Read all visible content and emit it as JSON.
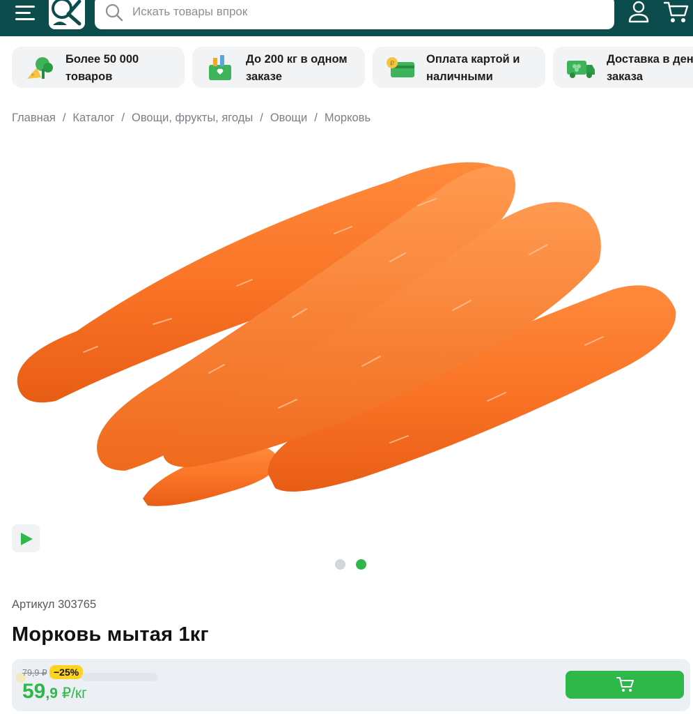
{
  "header": {
    "search_placeholder": "Искать товары впрок",
    "icons": [
      "menu-icon",
      "logo",
      "search-icon",
      "user-icon",
      "cart-icon"
    ],
    "colors": {
      "header_bg": "#0d4c4c",
      "accent": "#2eb84a"
    }
  },
  "features": [
    {
      "text": "Более 50 000 товаров",
      "icon": "vegetables-icon"
    },
    {
      "text": "До 200 кг в одном заказе",
      "icon": "grocery-bag-icon"
    },
    {
      "text": "Оплата картой и наличными",
      "icon": "payment-card-icon"
    },
    {
      "text": "Доставка в день заказа",
      "icon": "delivery-truck-icon"
    }
  ],
  "breadcrumb": {
    "items": [
      "Главная",
      "Каталог",
      "Овощи, фрукты, ягоды",
      "Овощи",
      "Морковь"
    ],
    "separator": "/"
  },
  "gallery": {
    "slides_total": 2,
    "active_slide": 2,
    "image_alt": "carrots-image"
  },
  "product": {
    "article": "Артикул 303765",
    "title": "Морковь мытая 1кг",
    "old_price": "79,9 ₽",
    "discount": "−25%",
    "price_int": "59",
    "price_frac": ",9",
    "price_unit": " ₽/кг"
  }
}
